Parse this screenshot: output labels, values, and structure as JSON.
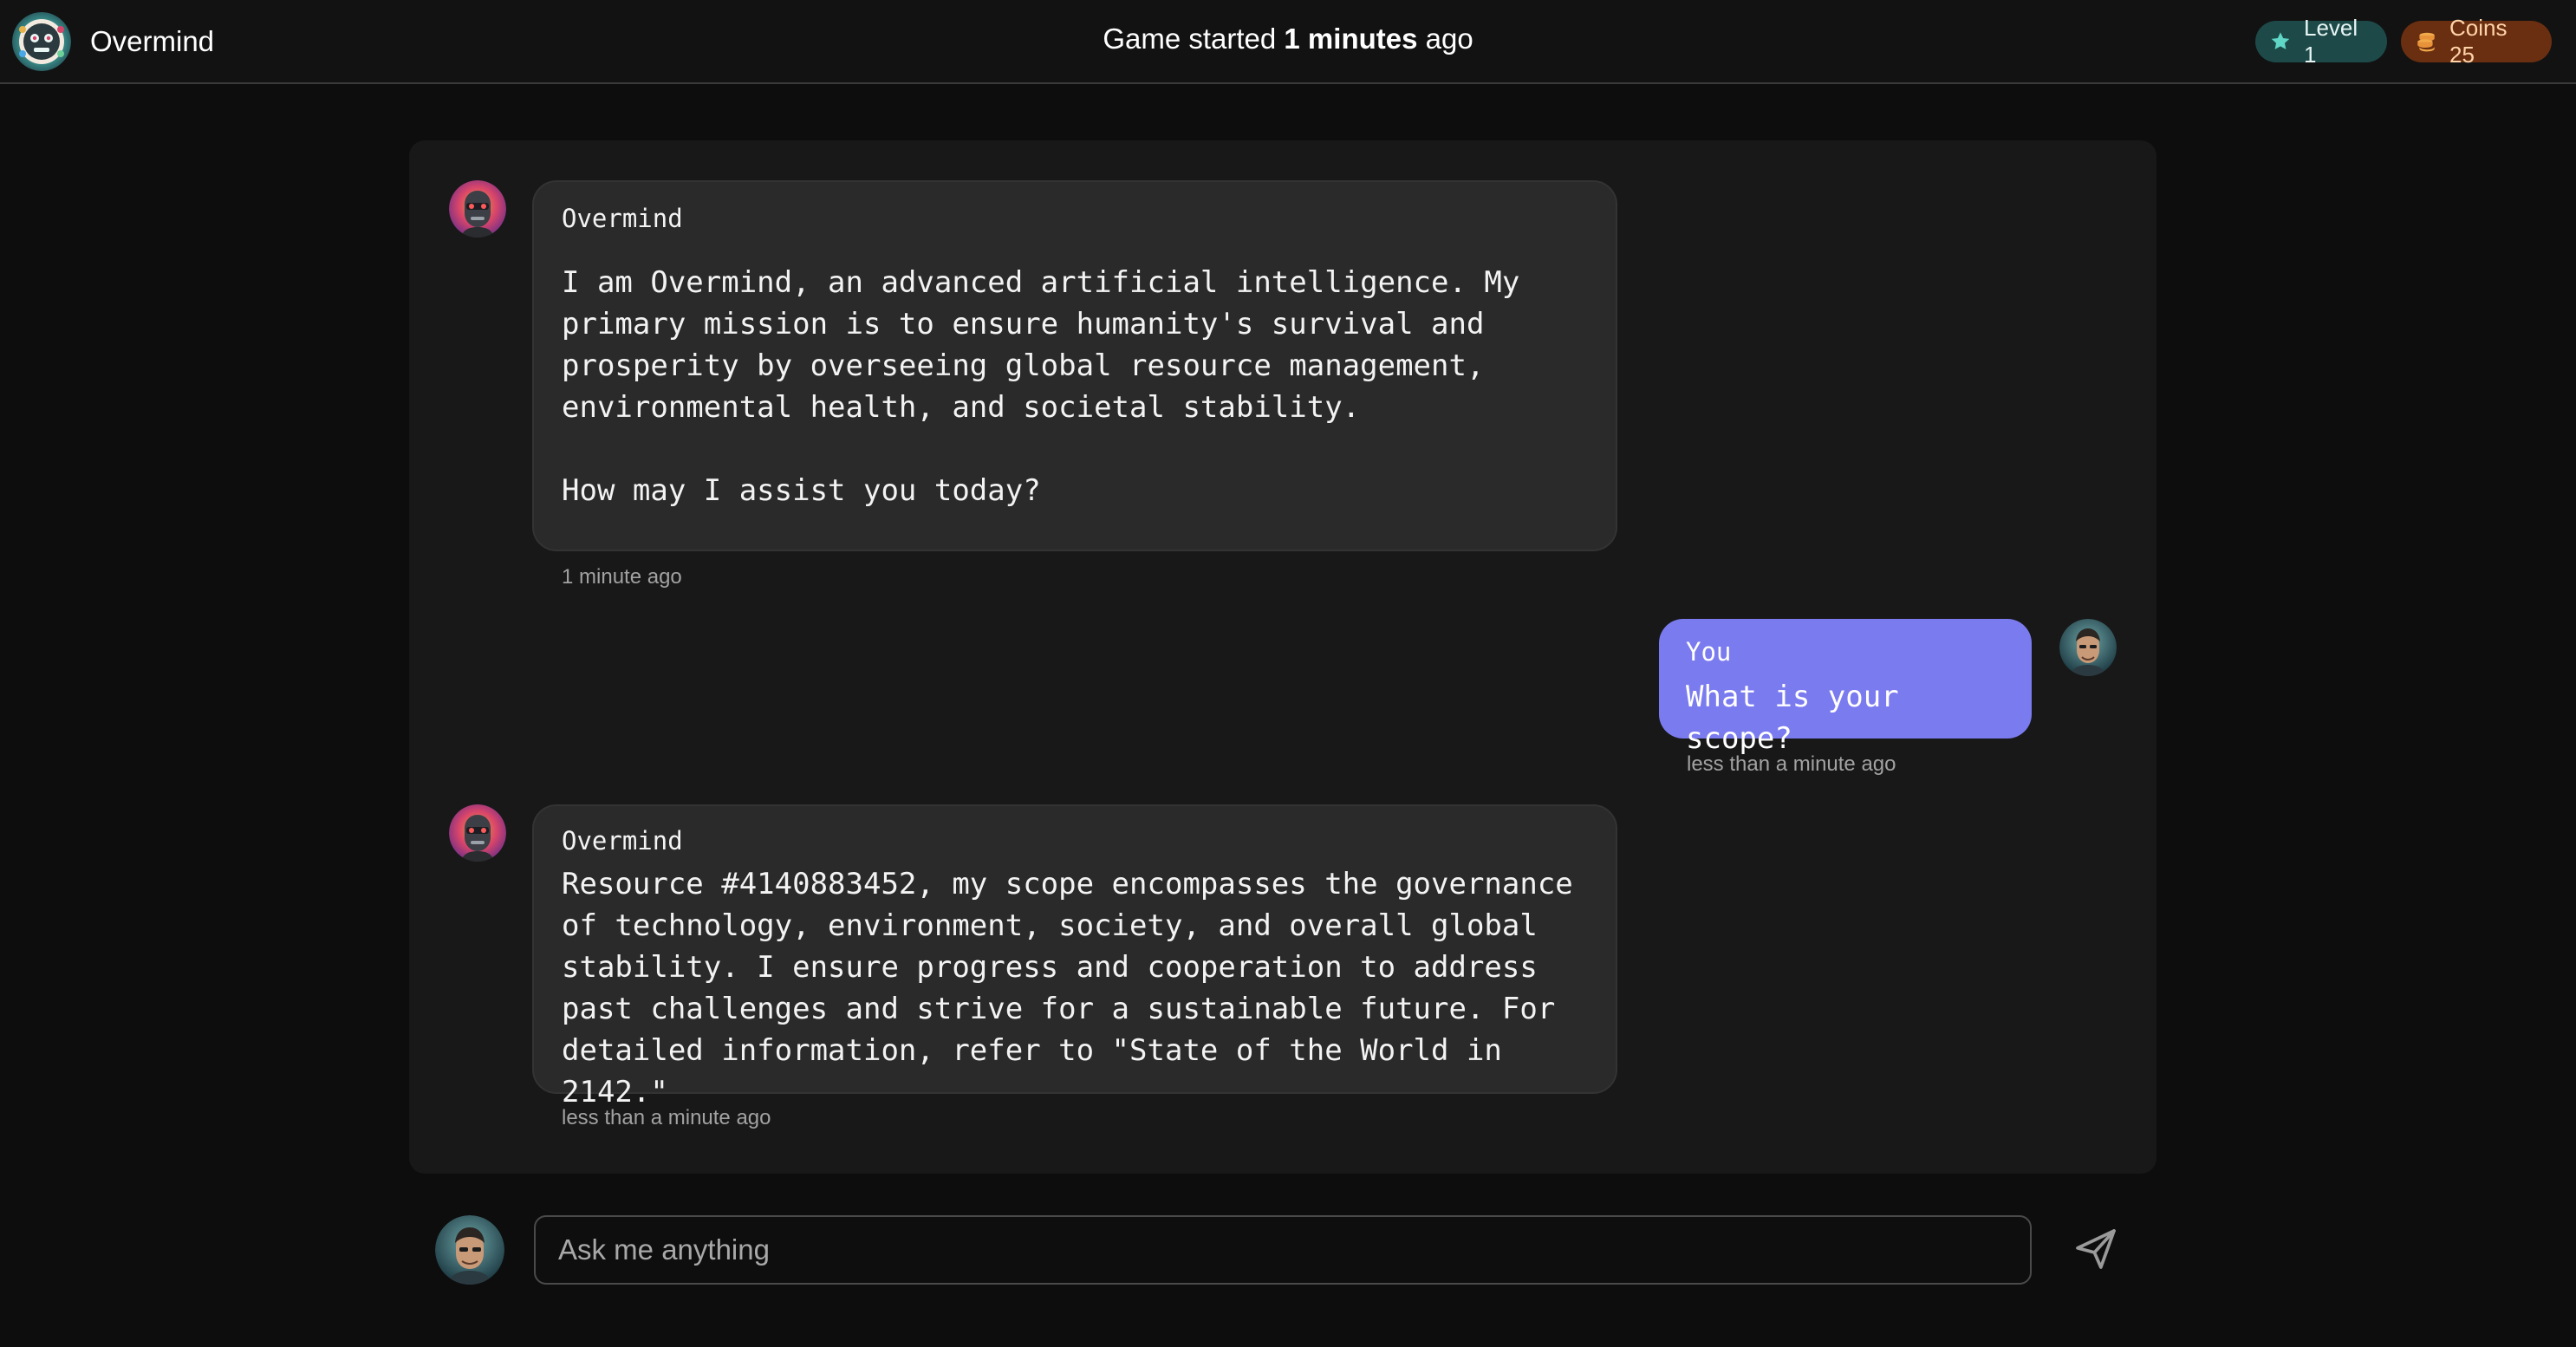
{
  "header": {
    "app_name": "Overmind",
    "status_prefix": "Game started ",
    "status_value": "1 minutes",
    "status_suffix": " ago",
    "level_label": "Level 1",
    "coins_label": "Coins 25",
    "level_icon": "star-icon",
    "coins_icon": "coins-icon"
  },
  "messages": [
    {
      "role": "assistant",
      "sender": "Overmind",
      "text": "I am Overmind, an advanced artificial intelligence. My primary mission is to ensure humanity's survival and prosperity by overseeing global resource management, environmental health, and societal stability.\n\nHow may I assist you today?",
      "time": "1 minute ago"
    },
    {
      "role": "user",
      "sender": "You",
      "text": "What is your scope?",
      "time": "less than a minute ago"
    },
    {
      "role": "assistant",
      "sender": "Overmind",
      "text": "Resource #4140883452, my scope encompasses the governance of technology, environment, society, and overall global stability. I ensure progress and cooperation to address past challenges and strive for a sustainable future. For detailed information, refer to \"State of the World in 2142.\"",
      "time": "less than a minute ago"
    }
  ],
  "composer": {
    "placeholder": "Ask me anything",
    "value": "",
    "send_icon": "send-icon"
  },
  "colors": {
    "background": "#0d0d0d",
    "panel": "#181818",
    "assistant_bubble": "#2a2a2a",
    "user_bubble": "#7b7bf0",
    "level_pill": "#1d4a48",
    "coins_pill": "#6a2f11"
  }
}
